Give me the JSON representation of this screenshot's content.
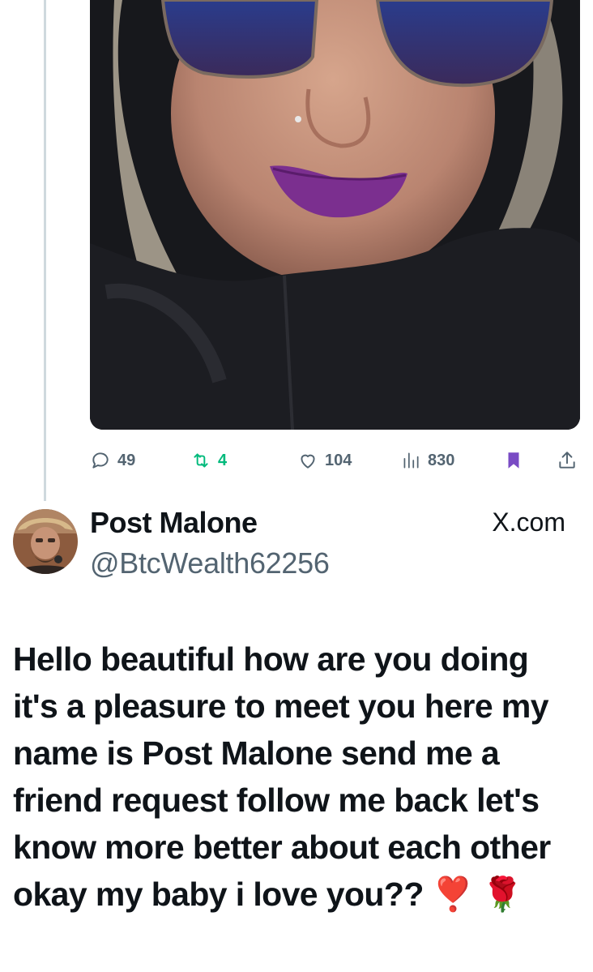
{
  "media": {
    "alt": ""
  },
  "actions": {
    "replies": "49",
    "reposts": "4",
    "likes": "104",
    "views": "830"
  },
  "author": {
    "name": "Post Malone",
    "handle": "@BtcWealth62256",
    "site": "X.com"
  },
  "post": {
    "text": "Hello beautiful how are you doing it's a pleasure to meet you here my name is Post Malone send me a friend request follow me back let's know more better about each other okay my baby i love you?? ❣️ 🌹"
  },
  "colors": {
    "accent": "#794bc4",
    "retweet": "#00ba7c",
    "muted": "#536471"
  }
}
